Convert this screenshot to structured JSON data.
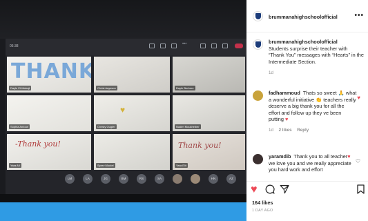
{
  "post": {
    "username": "brummanahighschoolofficial",
    "more_label": "•••",
    "caption": "Students surprise their teacher with “Thank You” messages with “Hearts” in the Intermediate Section.",
    "caption_time": "1d",
    "likes": "164 likes",
    "date": "1 DAY AGO"
  },
  "comments": [
    {
      "username": "fadhammoud",
      "text": "Thats so sweet 🙏 what a wonderful initiative 👏 teachers really deserve a big thank you for all the effort and follow up they ve been putting",
      "time": "1d",
      "likes": "2 likes",
      "reply": "Reply",
      "avatar_color": "#c9a33b",
      "liked": true
    },
    {
      "username": "yaramdib",
      "text_before": "Thank you to all teacher",
      "text_after": " we love you and we really appreciate you hard work and effort",
      "avatar_color": "#3b2f2f",
      "liked": false
    }
  ],
  "icons": {
    "like": "heart-icon",
    "comment": "comment-icon",
    "share": "paper-plane-icon",
    "save": "bookmark-icon"
  },
  "colors": {
    "like_red": "#ed4956",
    "text": "#262626",
    "muted": "#8e8e8e",
    "photo_blue_bar": "#2f9be4",
    "teams_end_call": "#c4314b"
  },
  "photo": {
    "screen_time": "05:38",
    "tiles": [
      {
        "name": "Dayle El-Matraji",
        "text": "THANK"
      },
      {
        "name": "Christ Aayssou"
      },
      {
        "name": "Dayle Berbere"
      },
      {
        "name": "Sophia Antoun"
      },
      {
        "name": "Christy Ougler"
      },
      {
        "name": "Nadim Moukheiber"
      },
      {
        "name": "Yara Atl",
        "text": "-Thank you!"
      },
      {
        "name": "Sprev Moutel"
      },
      {
        "name": "Yara Elit",
        "text": "Thank you!"
      }
    ],
    "avatars": [
      "LM",
      "LA",
      "JG",
      "BM",
      "RS",
      "SA",
      "",
      "",
      "HN",
      "AZ"
    ]
  }
}
